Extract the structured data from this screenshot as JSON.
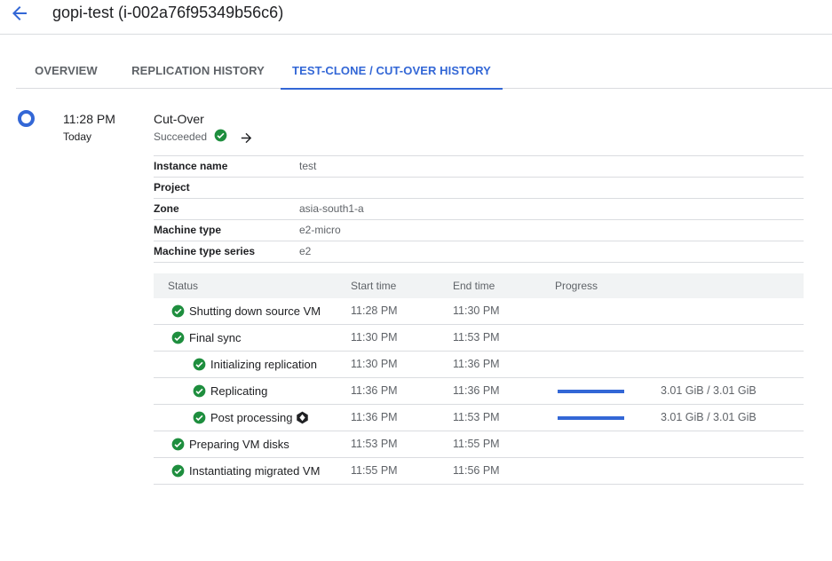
{
  "header": {
    "title": "gopi-test (i-002a76f95349b56c6)",
    "back_icon": "arrow-back-icon"
  },
  "tabs": [
    {
      "label": "OVERVIEW",
      "active": false
    },
    {
      "label": "REPLICATION HISTORY",
      "active": false
    },
    {
      "label": "TEST-CLONE / CUT-OVER HISTORY",
      "active": true
    }
  ],
  "event": {
    "time": "11:28 PM",
    "day": "Today",
    "title": "Cut-Over",
    "status": "Succeeded",
    "status_icon": "check-circle-icon",
    "arrow_icon": "arrow-forward-icon"
  },
  "details": [
    {
      "key": "Instance name",
      "value": "test"
    },
    {
      "key": "Project",
      "value": ""
    },
    {
      "key": "Zone",
      "value": "asia-south1-a"
    },
    {
      "key": "Machine type",
      "value": "e2-micro"
    },
    {
      "key": "Machine type series",
      "value": "e2"
    }
  ],
  "steps": {
    "columns": {
      "status": "Status",
      "start": "Start time",
      "end": "End time",
      "progress": "Progress"
    },
    "rows": [
      {
        "name": "Shutting down source VM",
        "start": "11:28 PM",
        "end": "11:30 PM",
        "progress_text": "",
        "progress_fraction": null,
        "level": 0,
        "busy_icon": false
      },
      {
        "name": "Final sync",
        "start": "11:30 PM",
        "end": "11:53 PM",
        "progress_text": "",
        "progress_fraction": null,
        "level": 0,
        "busy_icon": false
      },
      {
        "name": "Initializing replication",
        "start": "11:30 PM",
        "end": "11:36 PM",
        "progress_text": "",
        "progress_fraction": null,
        "level": 1,
        "busy_icon": false
      },
      {
        "name": "Replicating",
        "start": "11:36 PM",
        "end": "11:36 PM",
        "progress_text": "3.01 GiB / 3.01 GiB",
        "progress_fraction": 1.0,
        "level": 1,
        "busy_icon": false
      },
      {
        "name": "Post processing",
        "start": "11:36 PM",
        "end": "11:53 PM",
        "progress_text": "3.01 GiB / 3.01 GiB",
        "progress_fraction": 1.0,
        "level": 1,
        "busy_icon": true
      },
      {
        "name": "Preparing VM disks",
        "start": "11:53 PM",
        "end": "11:55 PM",
        "progress_text": "",
        "progress_fraction": null,
        "level": 0,
        "busy_icon": false
      },
      {
        "name": "Instantiating migrated VM",
        "start": "11:55 PM",
        "end": "11:56 PM",
        "progress_text": "",
        "progress_fraction": null,
        "level": 0,
        "busy_icon": false
      }
    ]
  },
  "colors": {
    "accent": "#3367d6",
    "success": "#1e8e3e",
    "muted": "#5f6368"
  }
}
